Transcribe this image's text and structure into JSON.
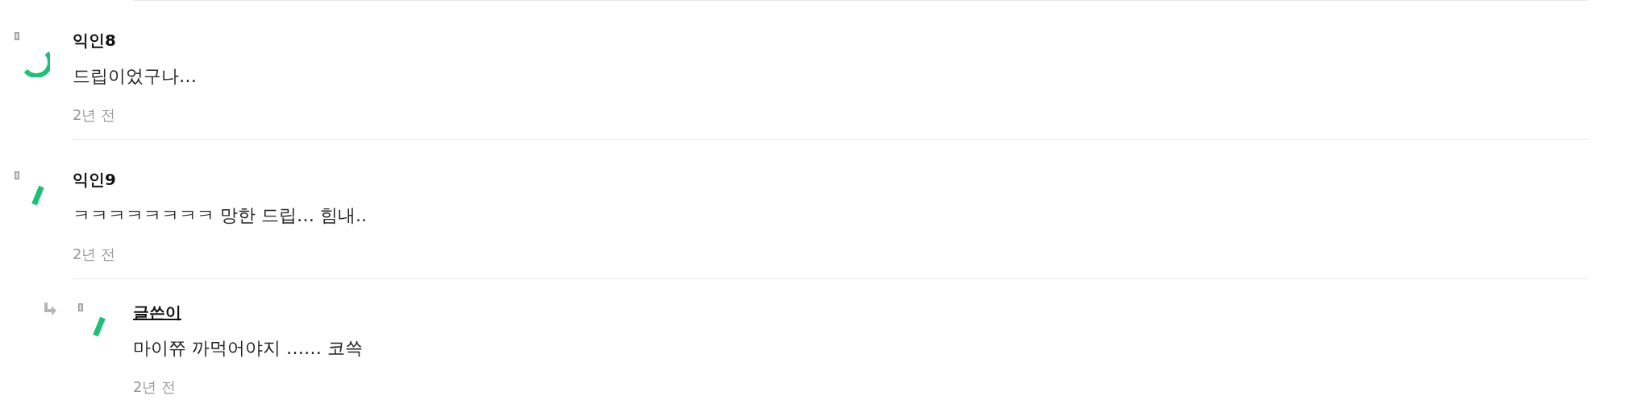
{
  "comments": [
    {
      "author": "익인8",
      "is_writer": false,
      "text": "드립이었구나…",
      "time": "2년 전"
    },
    {
      "author": "익인9",
      "is_writer": false,
      "text": "ㅋㅋㅋㅋㅋㅋㅋㅋ 망한 드립… 힘내..",
      "time": "2년 전",
      "replies": [
        {
          "author": "글쓴이",
          "is_writer": true,
          "text": "마이쮸 까먹어야지 …… 코쓱",
          "time": "2년 전"
        }
      ]
    }
  ]
}
